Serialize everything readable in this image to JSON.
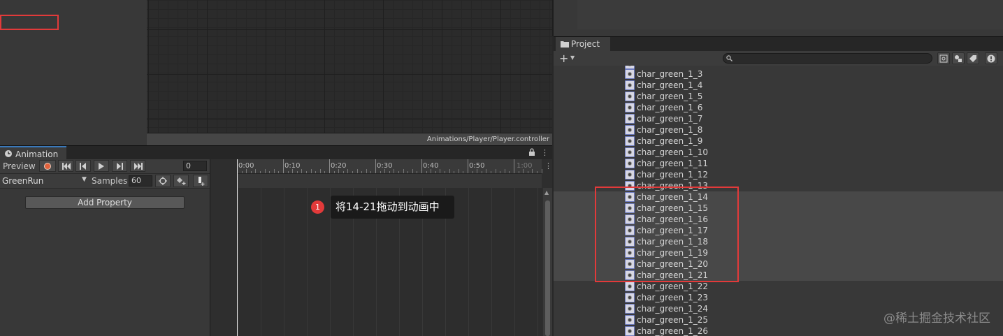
{
  "graph": {
    "controller_path": "Animations/Player/Player.controller"
  },
  "animation": {
    "tab_label": "Animation",
    "lock_icon": "lock-icon",
    "preview_label": "Preview",
    "current_frame": "0",
    "clip_name": "GreenRun",
    "samples_label": "Samples",
    "samples_value": "60",
    "add_property_label": "Add Property",
    "ruler_ticks": [
      "0:00",
      "0:10",
      "0:20",
      "0:30",
      "0:40",
      "0:50",
      "1:00"
    ]
  },
  "annotation": {
    "step_number": "1",
    "instruction": "将14-21拖动到动画中",
    "highlight_color": "#e23a3a"
  },
  "project": {
    "tab_label": "Project",
    "search_placeholder": "",
    "assets": [
      "char_green_1_3",
      "char_green_1_4",
      "char_green_1_5",
      "char_green_1_6",
      "char_green_1_7",
      "char_green_1_8",
      "char_green_1_9",
      "char_green_1_10",
      "char_green_1_11",
      "char_green_1_12",
      "char_green_1_13",
      "char_green_1_14",
      "char_green_1_15",
      "char_green_1_16",
      "char_green_1_17",
      "char_green_1_18",
      "char_green_1_19",
      "char_green_1_20",
      "char_green_1_21",
      "char_green_1_22",
      "char_green_1_23",
      "char_green_1_24",
      "char_green_1_25",
      "char_green_1_26"
    ],
    "selected_from": "char_green_1_14",
    "selected_to": "char_green_1_21"
  },
  "watermark": "@稀土掘金技术社区"
}
